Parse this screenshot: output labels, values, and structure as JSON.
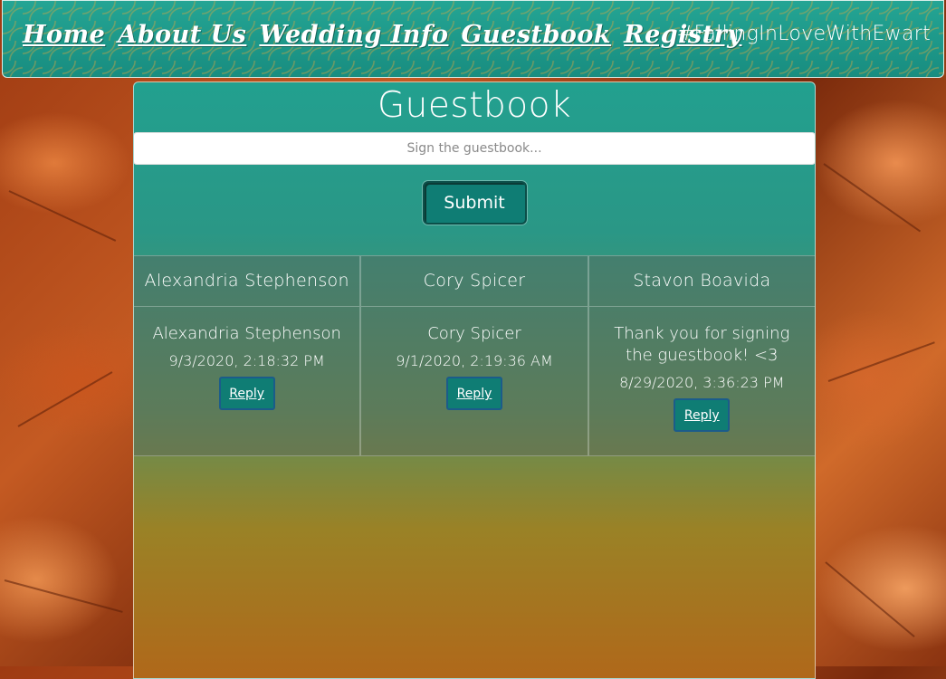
{
  "nav": {
    "links": [
      "Home",
      "About Us",
      "Wedding Info",
      "Guestbook",
      "Registry"
    ],
    "hashtag": "#FallingInLoveWithEwart"
  },
  "guestbook": {
    "title": "Guestbook",
    "input_placeholder": "Sign the guestbook...",
    "input_value": "",
    "submit_label": "Submit",
    "entries": [
      {
        "name": "Alexandria Stephenson",
        "message": "Alexandria Stephenson",
        "date": "9/3/2020, 2:18:32 PM",
        "reply_label": "Reply"
      },
      {
        "name": "Cory Spicer",
        "message": "Cory Spicer",
        "date": "9/1/2020, 2:19:36 AM",
        "reply_label": "Reply"
      },
      {
        "name": "Stavon Boavida",
        "message": "Thank you for signing the guestbook! <3",
        "date": "8/29/2020, 3:36:23 PM",
        "reply_label": "Reply"
      }
    ]
  },
  "colors": {
    "teal_primary": "#1f9a8c",
    "button_teal": "#0f7d74",
    "autumn_orange": "#c45a22"
  }
}
